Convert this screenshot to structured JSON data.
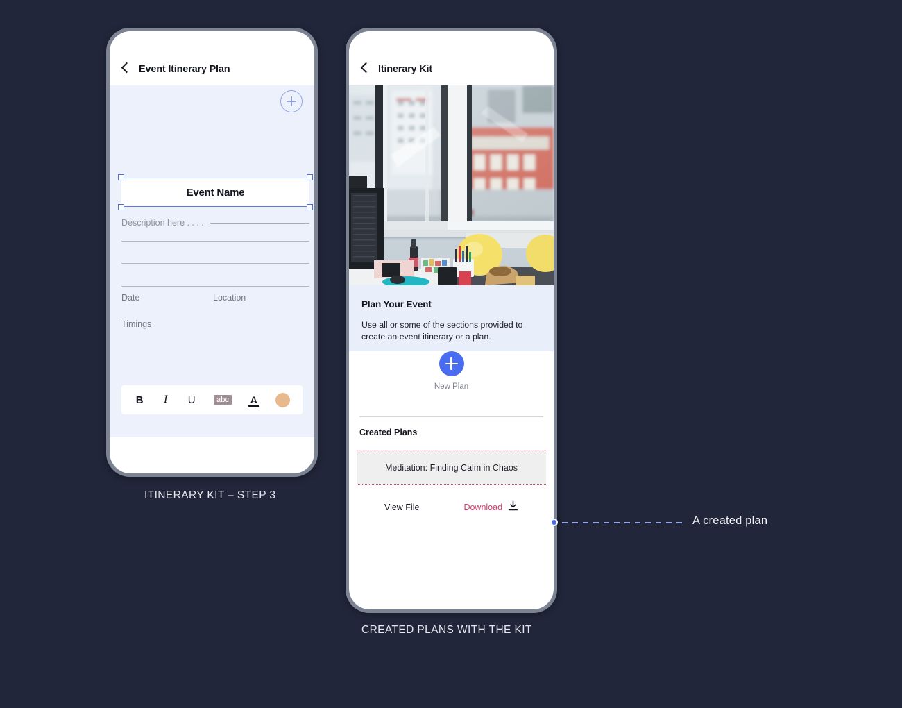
{
  "canvas": {
    "background_color": "#21263a",
    "phone_bezel_color": "#7c8494"
  },
  "phone1": {
    "caption": "ITINERARY KIT – STEP 3",
    "header": {
      "back_icon": "chevron-left-icon",
      "title": "Event Itinerary Plan"
    },
    "add_button_icon": "plus-circle-icon",
    "form": {
      "event_name_value": "Event Name",
      "description_placeholder": "Description here . . . .",
      "labels": {
        "date": "Date",
        "location": "Location",
        "timings": "Timings"
      }
    },
    "toolbar": {
      "bold_label": "B",
      "italic_label": "I",
      "underline_label": "U",
      "highlight_label": "abc",
      "text_color_label": "A",
      "swatch_color": "#e8b98d"
    }
  },
  "phone2": {
    "caption": "CREATED PLANS WITH THE KIT",
    "header": {
      "back_icon": "chevron-left-icon",
      "title": "Itinerary Kit"
    },
    "hero_image_alt": "office-desk-window-cityscape-photo",
    "plan_card": {
      "title": "Plan Your Event",
      "description": "Use all or some of the sections provided to create an event itinerary or a plan."
    },
    "new_plan": {
      "icon": "plus-icon",
      "label": "New Plan",
      "accent_color": "#4a6cf0"
    },
    "created_plans": {
      "section_title": "Created Plans",
      "items": [
        {
          "name": "Meditation: Finding Calm in Chaos"
        }
      ],
      "actions": {
        "view_label": "View File",
        "download_label": "Download",
        "download_icon": "download-icon",
        "download_color": "#cf3f72"
      }
    }
  },
  "annotation": {
    "label": "A created plan",
    "dot_color": "#4a6cf0",
    "line_color": "#96a6e6"
  }
}
